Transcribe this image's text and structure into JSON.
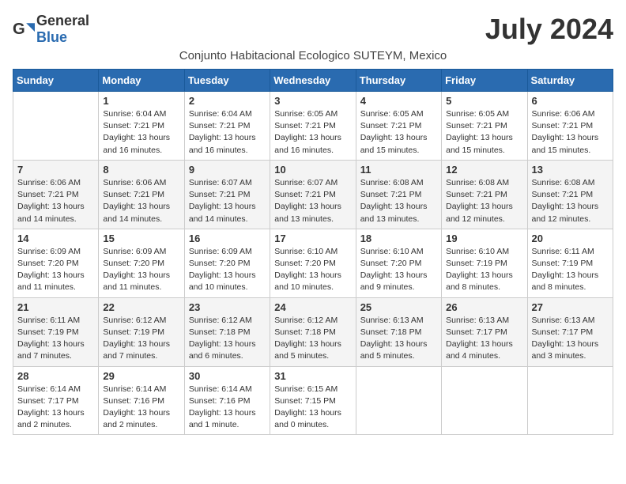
{
  "header": {
    "logo_general": "General",
    "logo_blue": "Blue",
    "month_title": "July 2024",
    "subtitle": "Conjunto Habitacional Ecologico SUTEYM, Mexico"
  },
  "days_of_week": [
    "Sunday",
    "Monday",
    "Tuesday",
    "Wednesday",
    "Thursday",
    "Friday",
    "Saturday"
  ],
  "weeks": [
    [
      {
        "day": "",
        "info": ""
      },
      {
        "day": "1",
        "info": "Sunrise: 6:04 AM\nSunset: 7:21 PM\nDaylight: 13 hours\nand 16 minutes."
      },
      {
        "day": "2",
        "info": "Sunrise: 6:04 AM\nSunset: 7:21 PM\nDaylight: 13 hours\nand 16 minutes."
      },
      {
        "day": "3",
        "info": "Sunrise: 6:05 AM\nSunset: 7:21 PM\nDaylight: 13 hours\nand 16 minutes."
      },
      {
        "day": "4",
        "info": "Sunrise: 6:05 AM\nSunset: 7:21 PM\nDaylight: 13 hours\nand 15 minutes."
      },
      {
        "day": "5",
        "info": "Sunrise: 6:05 AM\nSunset: 7:21 PM\nDaylight: 13 hours\nand 15 minutes."
      },
      {
        "day": "6",
        "info": "Sunrise: 6:06 AM\nSunset: 7:21 PM\nDaylight: 13 hours\nand 15 minutes."
      }
    ],
    [
      {
        "day": "7",
        "info": "Sunrise: 6:06 AM\nSunset: 7:21 PM\nDaylight: 13 hours\nand 14 minutes."
      },
      {
        "day": "8",
        "info": "Sunrise: 6:06 AM\nSunset: 7:21 PM\nDaylight: 13 hours\nand 14 minutes."
      },
      {
        "day": "9",
        "info": "Sunrise: 6:07 AM\nSunset: 7:21 PM\nDaylight: 13 hours\nand 14 minutes."
      },
      {
        "day": "10",
        "info": "Sunrise: 6:07 AM\nSunset: 7:21 PM\nDaylight: 13 hours\nand 13 minutes."
      },
      {
        "day": "11",
        "info": "Sunrise: 6:08 AM\nSunset: 7:21 PM\nDaylight: 13 hours\nand 13 minutes."
      },
      {
        "day": "12",
        "info": "Sunrise: 6:08 AM\nSunset: 7:21 PM\nDaylight: 13 hours\nand 12 minutes."
      },
      {
        "day": "13",
        "info": "Sunrise: 6:08 AM\nSunset: 7:21 PM\nDaylight: 13 hours\nand 12 minutes."
      }
    ],
    [
      {
        "day": "14",
        "info": "Sunrise: 6:09 AM\nSunset: 7:20 PM\nDaylight: 13 hours\nand 11 minutes."
      },
      {
        "day": "15",
        "info": "Sunrise: 6:09 AM\nSunset: 7:20 PM\nDaylight: 13 hours\nand 11 minutes."
      },
      {
        "day": "16",
        "info": "Sunrise: 6:09 AM\nSunset: 7:20 PM\nDaylight: 13 hours\nand 10 minutes."
      },
      {
        "day": "17",
        "info": "Sunrise: 6:10 AM\nSunset: 7:20 PM\nDaylight: 13 hours\nand 10 minutes."
      },
      {
        "day": "18",
        "info": "Sunrise: 6:10 AM\nSunset: 7:20 PM\nDaylight: 13 hours\nand 9 minutes."
      },
      {
        "day": "19",
        "info": "Sunrise: 6:10 AM\nSunset: 7:19 PM\nDaylight: 13 hours\nand 8 minutes."
      },
      {
        "day": "20",
        "info": "Sunrise: 6:11 AM\nSunset: 7:19 PM\nDaylight: 13 hours\nand 8 minutes."
      }
    ],
    [
      {
        "day": "21",
        "info": "Sunrise: 6:11 AM\nSunset: 7:19 PM\nDaylight: 13 hours\nand 7 minutes."
      },
      {
        "day": "22",
        "info": "Sunrise: 6:12 AM\nSunset: 7:19 PM\nDaylight: 13 hours\nand 7 minutes."
      },
      {
        "day": "23",
        "info": "Sunrise: 6:12 AM\nSunset: 7:18 PM\nDaylight: 13 hours\nand 6 minutes."
      },
      {
        "day": "24",
        "info": "Sunrise: 6:12 AM\nSunset: 7:18 PM\nDaylight: 13 hours\nand 5 minutes."
      },
      {
        "day": "25",
        "info": "Sunrise: 6:13 AM\nSunset: 7:18 PM\nDaylight: 13 hours\nand 5 minutes."
      },
      {
        "day": "26",
        "info": "Sunrise: 6:13 AM\nSunset: 7:17 PM\nDaylight: 13 hours\nand 4 minutes."
      },
      {
        "day": "27",
        "info": "Sunrise: 6:13 AM\nSunset: 7:17 PM\nDaylight: 13 hours\nand 3 minutes."
      }
    ],
    [
      {
        "day": "28",
        "info": "Sunrise: 6:14 AM\nSunset: 7:17 PM\nDaylight: 13 hours\nand 2 minutes."
      },
      {
        "day": "29",
        "info": "Sunrise: 6:14 AM\nSunset: 7:16 PM\nDaylight: 13 hours\nand 2 minutes."
      },
      {
        "day": "30",
        "info": "Sunrise: 6:14 AM\nSunset: 7:16 PM\nDaylight: 13 hours\nand 1 minute."
      },
      {
        "day": "31",
        "info": "Sunrise: 6:15 AM\nSunset: 7:15 PM\nDaylight: 13 hours\nand 0 minutes."
      },
      {
        "day": "",
        "info": ""
      },
      {
        "day": "",
        "info": ""
      },
      {
        "day": "",
        "info": ""
      }
    ]
  ]
}
